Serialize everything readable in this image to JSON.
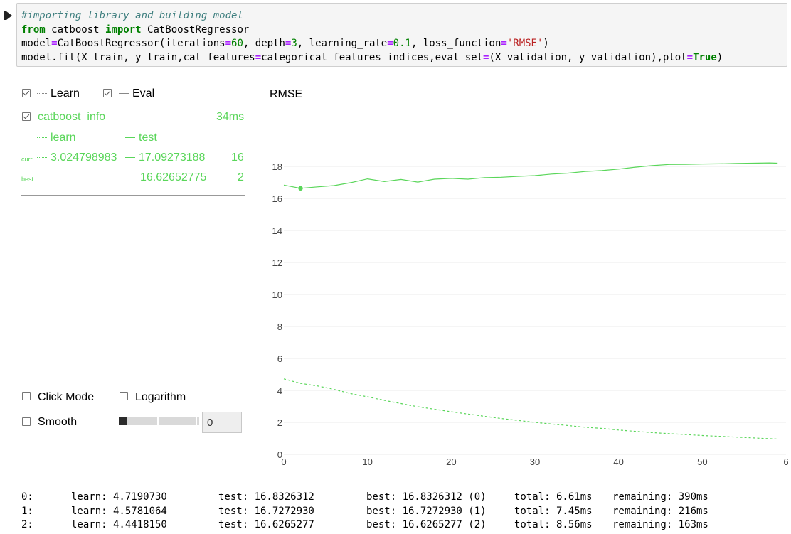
{
  "code": {
    "line1_comment": "#importing library and building model",
    "line2": {
      "from": "from",
      "module": " catboost ",
      "import": "import",
      "name": " CatBoostRegressor"
    },
    "line3": {
      "a": "model",
      "eq": "=",
      "b": "CatBoostRegressor(iterations",
      "eq2": "=",
      "iter": "60",
      "c": ", depth",
      "eq3": "=",
      "depth": "3",
      "d": ", learning_rate",
      "eq4": "=",
      "lr": "0.1",
      "e": ", loss_function",
      "eq5": "=",
      "loss": "'RMSE'",
      "f": ")"
    },
    "line4": {
      "a": "model.fit(X_train, y_train,cat_features",
      "eq": "=",
      "b": "categorical_features_indices,eval_set",
      "eq2": "=",
      "c": "(X_validation, y_validation),plot",
      "eq3": "=",
      "true": "True",
      "d": ")"
    }
  },
  "widget": {
    "learn_label": "Learn",
    "eval_label": "Eval",
    "info_label": "catboost_info",
    "time": "34ms",
    "col_learn": "learn",
    "col_test": "test",
    "curr_label": "curr",
    "curr_learn": "3.024798983",
    "curr_test": "17.09273188",
    "curr_iter": "16",
    "best_label": "best",
    "best_test": "16.62652775",
    "best_iter": "2",
    "click_mode": "Click Mode",
    "logarithm": "Logarithm",
    "smooth": "Smooth",
    "smooth_value": "0"
  },
  "chart_data": {
    "type": "line",
    "title": "RMSE",
    "xlim": [
      0,
      60
    ],
    "ylim": [
      0,
      18
    ],
    "x_ticks": [
      "0",
      "10",
      "20",
      "30",
      "40",
      "50",
      "6"
    ],
    "y_ticks": [
      "0",
      "2",
      "4",
      "6",
      "8",
      "10",
      "12",
      "14",
      "16",
      "18"
    ],
    "grid": true,
    "series": [
      {
        "name": "test",
        "style": "solid",
        "color": "#5ad65a",
        "x": [
          0,
          2,
          4,
          6,
          8,
          10,
          12,
          14,
          16,
          18,
          20,
          22,
          24,
          26,
          28,
          30,
          32,
          34,
          36,
          38,
          40,
          42,
          44,
          46,
          48,
          50,
          52,
          54,
          56,
          58,
          59
        ],
        "y": [
          16.83,
          16.63,
          16.72,
          16.8,
          16.98,
          17.22,
          17.05,
          17.18,
          17.02,
          17.2,
          17.25,
          17.2,
          17.3,
          17.32,
          17.38,
          17.42,
          17.52,
          17.58,
          17.68,
          17.74,
          17.83,
          17.95,
          18.05,
          18.12,
          18.13,
          18.15,
          18.16,
          18.18,
          18.2,
          18.22,
          18.2
        ]
      },
      {
        "name": "learn",
        "style": "dotted",
        "color": "#5ad65a",
        "x": [
          0,
          2,
          4,
          6,
          8,
          10,
          12,
          14,
          16,
          18,
          20,
          22,
          24,
          26,
          28,
          30,
          32,
          34,
          36,
          38,
          40,
          42,
          44,
          46,
          48,
          50,
          52,
          54,
          56,
          58,
          59
        ],
        "y": [
          4.72,
          4.44,
          4.28,
          4.06,
          3.8,
          3.6,
          3.38,
          3.18,
          2.98,
          2.82,
          2.66,
          2.52,
          2.38,
          2.24,
          2.12,
          2.0,
          1.9,
          1.8,
          1.7,
          1.62,
          1.52,
          1.44,
          1.36,
          1.3,
          1.24,
          1.18,
          1.13,
          1.08,
          1.03,
          0.98,
          0.96
        ]
      }
    ],
    "best_point": {
      "x": 2,
      "y": 16.63
    }
  },
  "log": [
    {
      "iter": "0:",
      "learn": "learn: 4.7190730",
      "test": "test: 16.8326312",
      "best": "best: 16.8326312 (0)",
      "total": "total: 6.61ms",
      "remaining": "remaining: 390ms"
    },
    {
      "iter": "1:",
      "learn": "learn: 4.5781064",
      "test": "test: 16.7272930",
      "best": "best: 16.7272930 (1)",
      "total": "total: 7.45ms",
      "remaining": "remaining: 216ms"
    },
    {
      "iter": "2:",
      "learn": "learn: 4.4418150",
      "test": "test: 16.6265277",
      "best": "best: 16.6265277 (2)",
      "total": "total: 8.56ms",
      "remaining": "remaining: 163ms"
    }
  ]
}
